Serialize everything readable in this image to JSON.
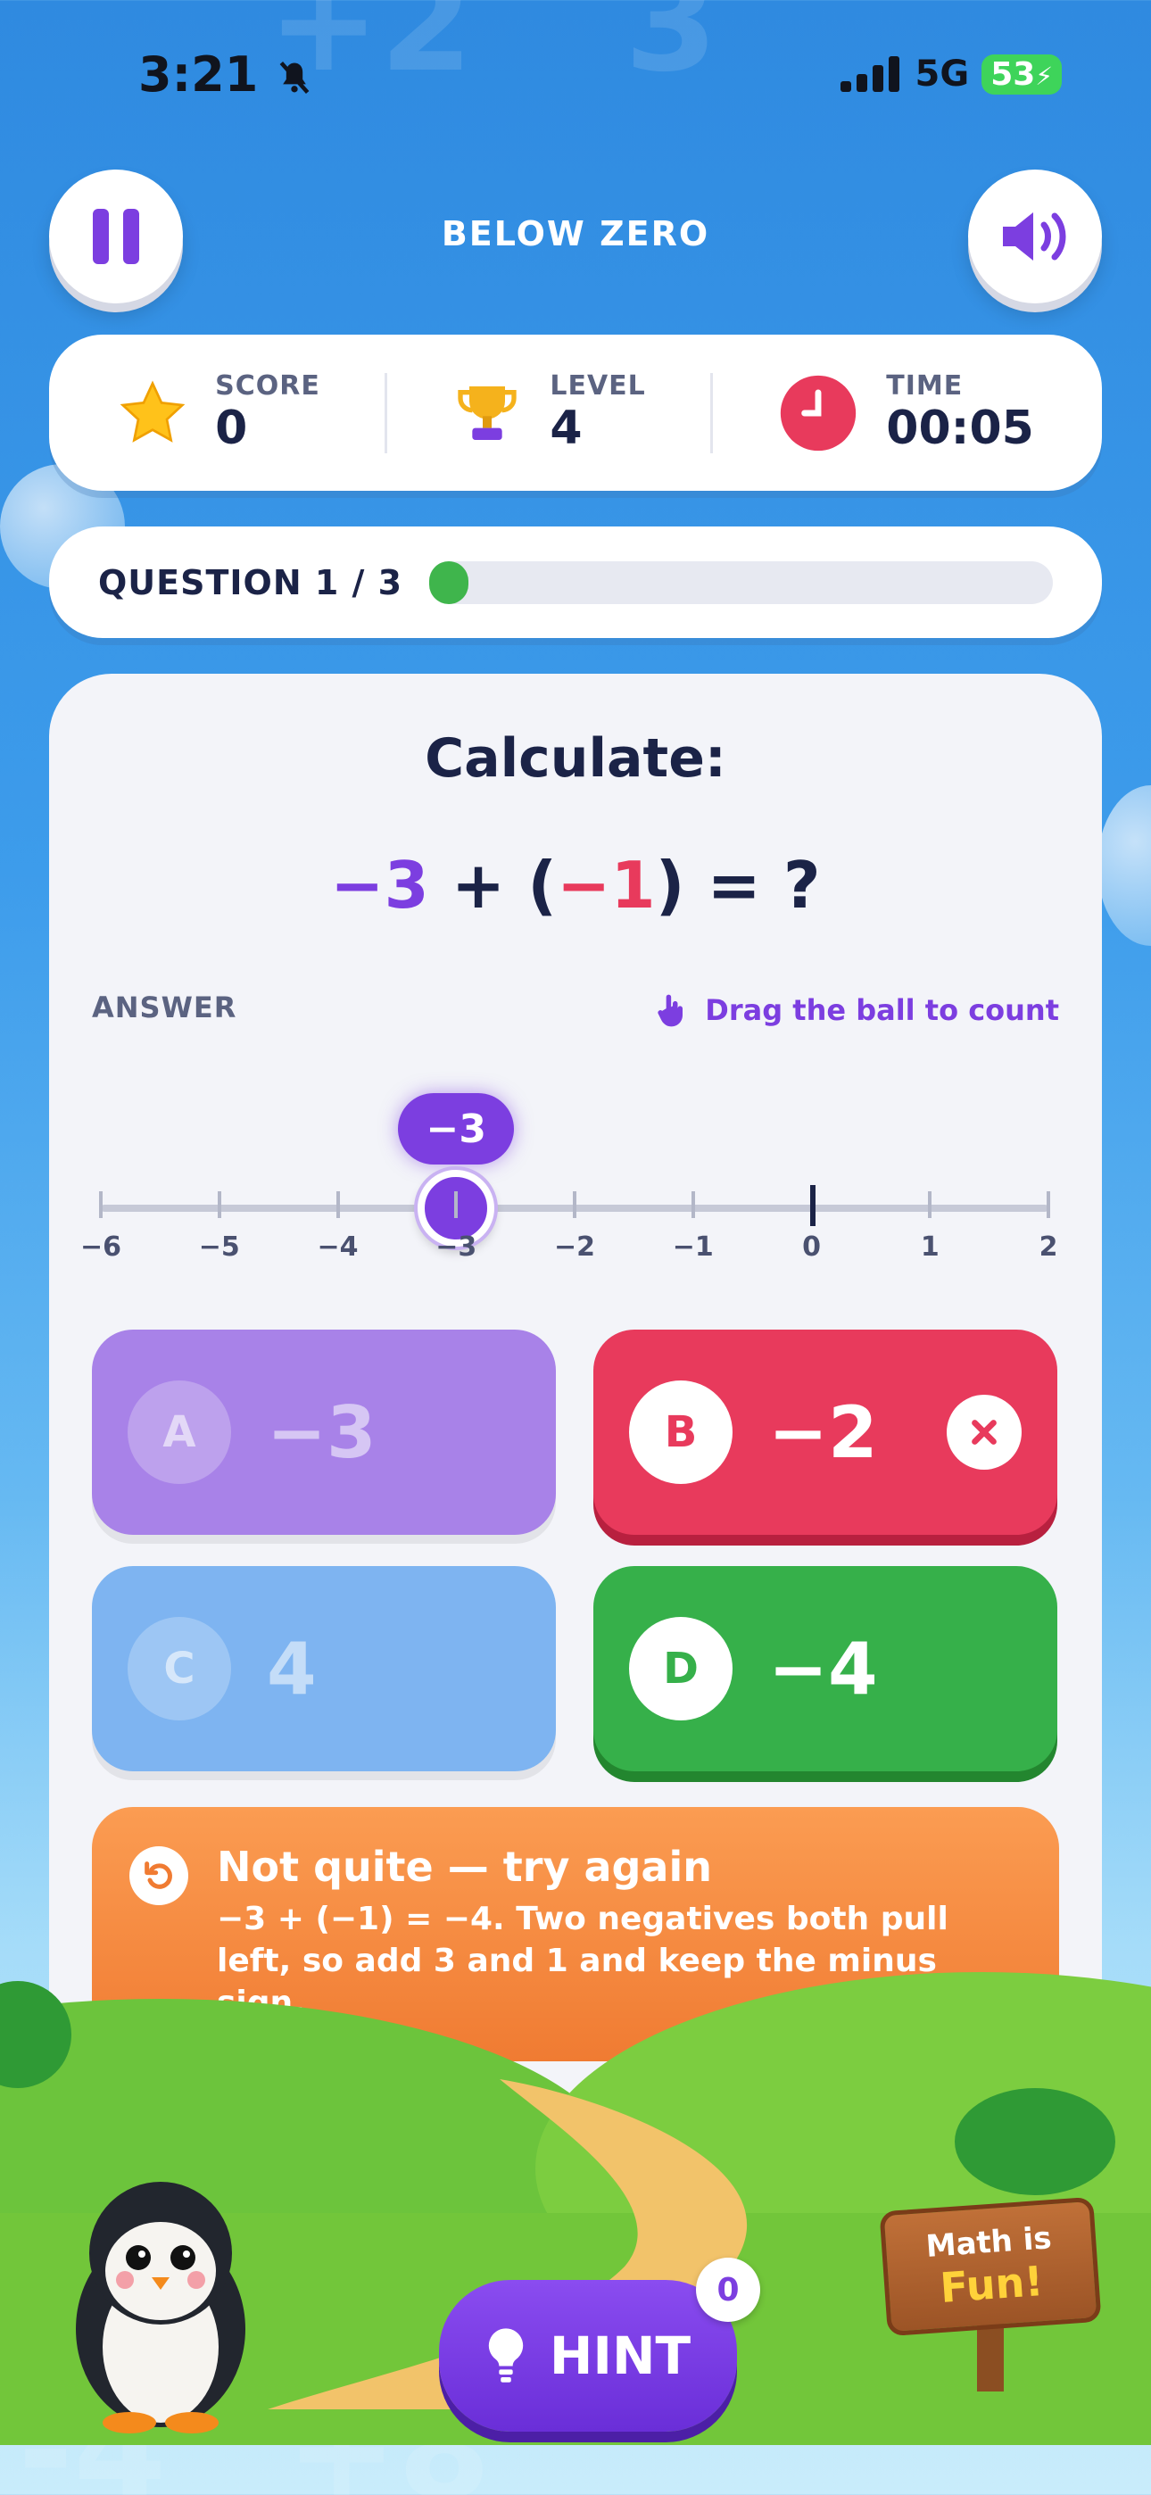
{
  "status": {
    "time": "3:21",
    "signal_label": "5G",
    "battery": "53"
  },
  "header": {
    "title": "BELOW ZERO"
  },
  "stats": {
    "score_label": "SCORE",
    "score_value": "0",
    "level_label": "LEVEL",
    "level_value": "4",
    "time_label": "TIME",
    "time_value": "00:05"
  },
  "progress": {
    "label": "QUESTION 1 / 3",
    "fraction": 0.05
  },
  "question": {
    "heading": "Calculate:",
    "a": "−3",
    "plus": "+ (",
    "b": "−1",
    "close": ") = ?"
  },
  "answer": {
    "label": "ANSWER",
    "drag_hint": "Drag the ball to count",
    "ball_value": "−3"
  },
  "number_line": {
    "ticks": [
      "−6",
      "−5",
      "−4",
      "−3",
      "−2",
      "−1",
      "0",
      "1",
      "2"
    ],
    "selected": -3
  },
  "options": [
    {
      "letter": "A",
      "value": "−3",
      "state": "faded",
      "color": "#9b6fe6"
    },
    {
      "letter": "B",
      "value": "−2",
      "state": "wrong",
      "color": "#e83a5c"
    },
    {
      "letter": "C",
      "value": "4",
      "state": "faded",
      "color": "#6aaaf0"
    },
    {
      "letter": "D",
      "value": "−4",
      "state": "correct",
      "color": "#36b04a"
    }
  ],
  "feedback": {
    "title": "Not quite — try again",
    "body": "−3 + (−1) = −4. Two negatives both pull left, so add 3 and 1 and keep the minus sign."
  },
  "sign": {
    "line1": "Math is",
    "line2": "Fun!"
  },
  "hint": {
    "label": "HINT",
    "count": "0"
  }
}
